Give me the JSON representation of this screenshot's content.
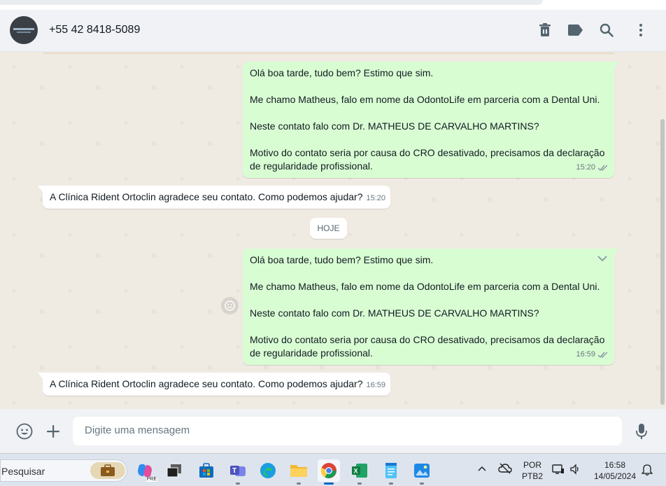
{
  "header": {
    "contact_name": "+55 42 8418-5089",
    "icons": [
      "delete-icon",
      "label-icon",
      "search-icon",
      "menu-icon"
    ]
  },
  "messages": [
    {
      "direction": "outgoing",
      "paragraphs": [
        "Olá boa tarde, tudo bem? Estimo que sim.",
        "Me chamo Matheus, falo em nome da OdontoLife em parceria com a Dental Uni.",
        "Neste contato falo com Dr. MATHEUS DE CARVALHO MARTINS?",
        "Motivo do contato seria por causa do CRO desativado, precisamos da declaração de regularidade profissional."
      ],
      "time": "15:20",
      "status": "read"
    },
    {
      "direction": "incoming",
      "text": "A Clínica Rident Ortoclin agradece seu contato. Como podemos ajudar?",
      "time": "15:20"
    },
    {
      "direction": "outgoing",
      "paragraphs": [
        "Olá boa tarde, tudo bem? Estimo que sim.",
        "Me chamo Matheus, falo em nome da OdontoLife em parceria com a Dental Uni.",
        "Neste contato falo com Dr. MATHEUS DE CARVALHO MARTINS?",
        "Motivo do contato seria por causa do CRO desativado, precisamos da declaração de regularidade profissional."
      ],
      "time": "16:59",
      "status": "read"
    },
    {
      "direction": "incoming",
      "text": "A Clínica Rident Ortoclin agradece seu contato. Como podemos ajudar?",
      "time": "16:59"
    }
  ],
  "date_divider": "HOJE",
  "composer": {
    "placeholder": "Digite uma mensagem"
  },
  "taskbar": {
    "search_label": "Pesquisar",
    "language": "POR",
    "keyboard": "PTB2",
    "time": "16:58",
    "date": "14/05/2024",
    "copilot_badge": "PRE"
  },
  "colors": {
    "outgoing_bubble": "#d9fdd3",
    "incoming_bubble": "#ffffff",
    "chat_background": "#efeae2",
    "read_ticks": "#8696a0"
  }
}
